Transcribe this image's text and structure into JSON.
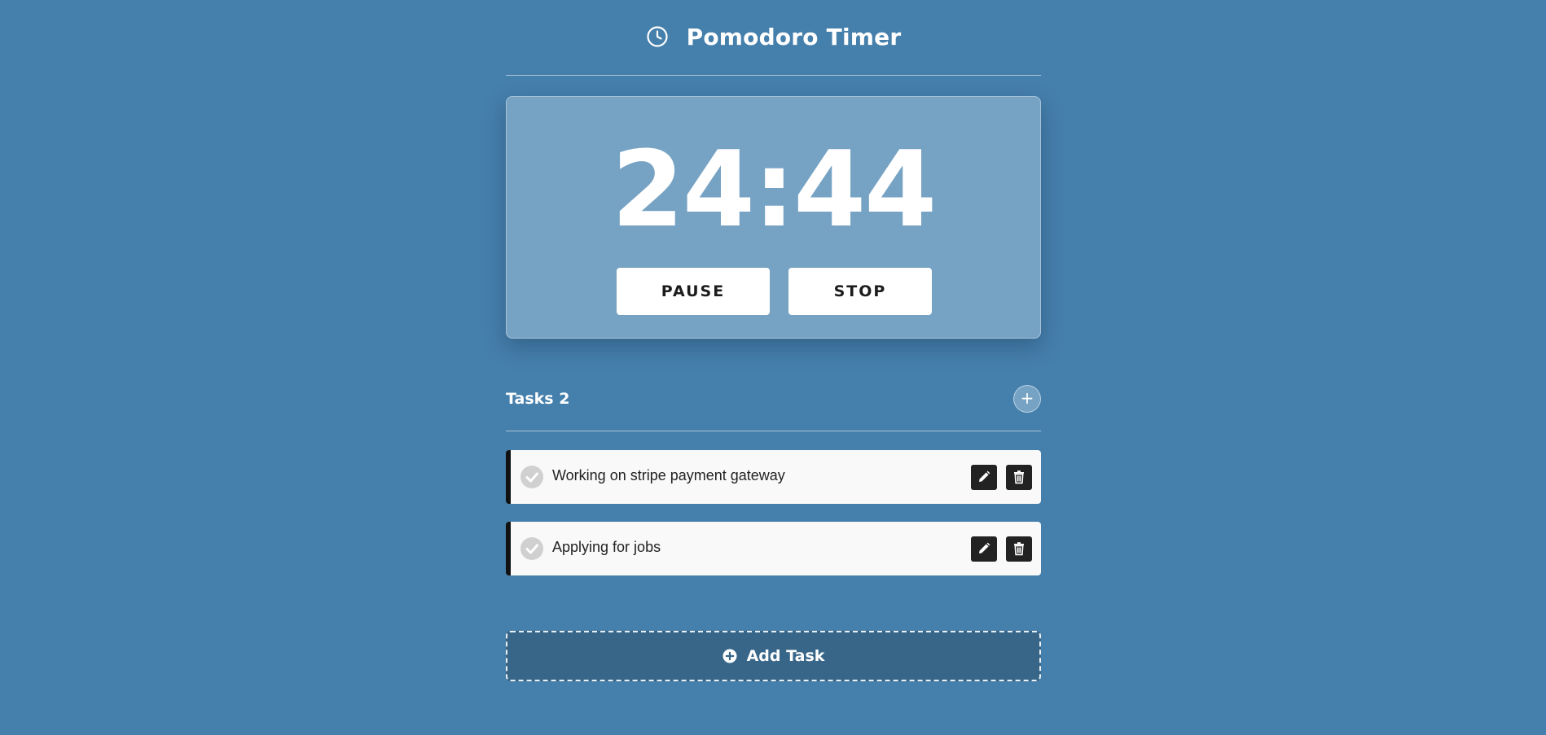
{
  "header": {
    "title": "Pomodoro Timer",
    "icon": "clock-icon"
  },
  "timer": {
    "display": "24:44",
    "pause_label": "PAUSE",
    "stop_label": "STOP"
  },
  "tasks": {
    "heading": "Tasks 2",
    "add_icon": "+",
    "items": [
      {
        "text": "Working on stripe payment gateway"
      },
      {
        "text": "Applying for jobs"
      }
    ]
  },
  "add_task": {
    "label": "Add Task"
  },
  "colors": {
    "background": "#457fab",
    "card": "#76a3c4",
    "add_task_bg": "#386689",
    "task_bg": "#f9f9f9",
    "task_accent": "#111111",
    "action_button": "#222222"
  }
}
